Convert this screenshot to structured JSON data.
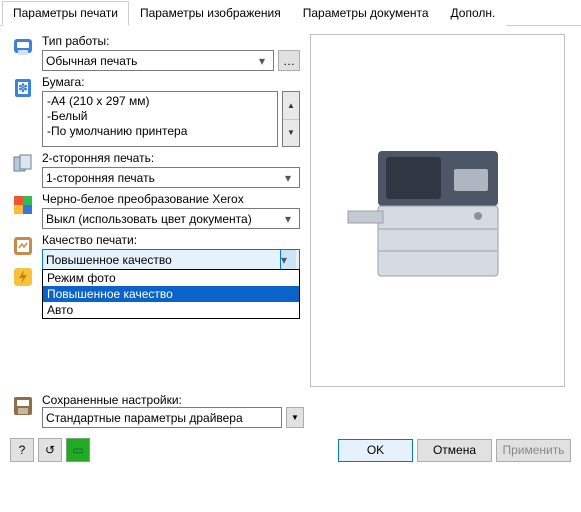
{
  "tabs": [
    "Параметры печати",
    "Параметры изображения",
    "Параметры документа",
    "Дополн."
  ],
  "jobType": {
    "label": "Тип работы:",
    "value": "Обычная печать"
  },
  "paper": {
    "label": "Бумага:",
    "lines": [
      "-A4 (210 x 297 мм)",
      "-Белый",
      "-По умолчанию принтера"
    ]
  },
  "duplex": {
    "label": "2-сторонняя печать:",
    "value": "1-сторонняя печать"
  },
  "bw": {
    "label": "Черно-белое преобразование Xerox",
    "value": "Выкл (использовать цвет документа)"
  },
  "quality": {
    "label": "Качество печати:",
    "value": "Повышенное качество",
    "options": [
      "Режим фото",
      "Повышенное качество",
      "Авто"
    ]
  },
  "saved": {
    "label": "Сохраненные настройки:",
    "value": "Стандартные параметры драйвера"
  },
  "buttons": {
    "ok": "OK",
    "cancel": "Отмена",
    "apply": "Применить",
    "help": "?"
  }
}
